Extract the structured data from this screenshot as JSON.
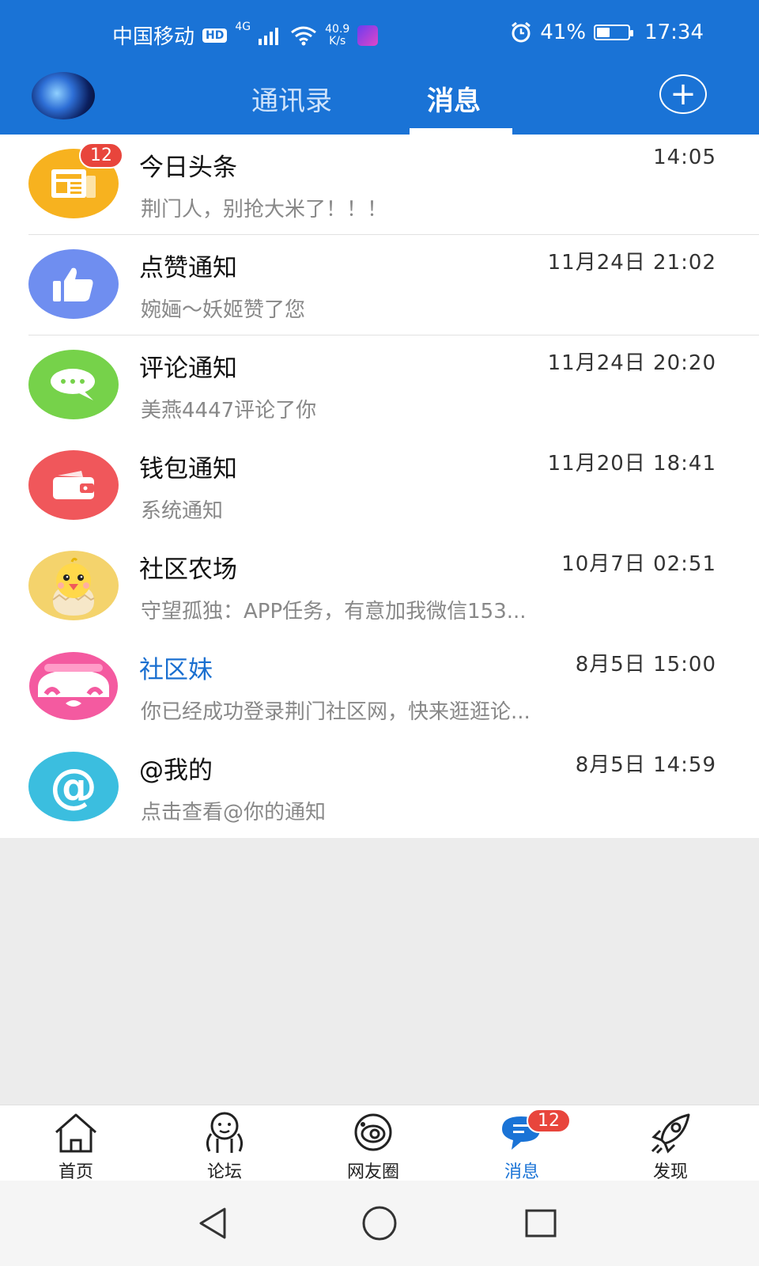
{
  "status_bar": {
    "carrier": "中国移动",
    "hd": "HD",
    "network": "4G",
    "speed_value": "40.9",
    "speed_unit": "K/s",
    "battery_percent": "41%",
    "battery_level": 0.41,
    "time": "17:34"
  },
  "header": {
    "tabs": [
      "通讯录",
      "消息"
    ],
    "active_tab": "消息"
  },
  "messages": [
    {
      "title": "今日头条",
      "time": "14:05",
      "preview": "荆门人，别抢大米了！！！",
      "badge": "12",
      "icon": "newspaper-icon",
      "color": "#f7b21f"
    },
    {
      "title": "点赞通知",
      "time": "11月24日 21:02",
      "preview": "婉婳～妖姬赞了您",
      "icon": "thumbs-up-icon",
      "color": "#6f8ef0"
    },
    {
      "title": "评论通知",
      "time": "11月24日 20:20",
      "preview": "美燕4447评论了你",
      "icon": "chat-bubble-icon",
      "color": "#76d24a"
    },
    {
      "title": "钱包通知",
      "time": "11月20日 18:41",
      "preview": "系统通知",
      "icon": "wallet-icon",
      "color": "#f0575b"
    },
    {
      "title": "社区农场",
      "time": "10月7日 02:51",
      "preview": "守望孤独：APP任务，有意加我微信153...",
      "icon": "chick-icon",
      "color": "#f4d36c"
    },
    {
      "title": "社区妹",
      "time": "8月5日 15:00",
      "preview": "你已经成功登录荆门社区网，快来逛逛论...",
      "icon": "girl-face-icon",
      "color": "#f45aa0"
    },
    {
      "title": "@我的",
      "time": "8月5日 14:59",
      "preview": "点击查看@你的通知",
      "icon": "at-sign-icon",
      "color": "#3bbedf"
    }
  ],
  "bottom_nav": [
    {
      "label": "首页",
      "icon": "home-icon"
    },
    {
      "label": "论坛",
      "icon": "forum-icon"
    },
    {
      "label": "网友圈",
      "icon": "planet-icon"
    },
    {
      "label": "消息",
      "icon": "message-icon",
      "badge": "12",
      "active": true
    },
    {
      "label": "发现",
      "icon": "rocket-icon"
    }
  ],
  "colors": {
    "primary": "#1a73d6",
    "badge": "#e8453c"
  }
}
